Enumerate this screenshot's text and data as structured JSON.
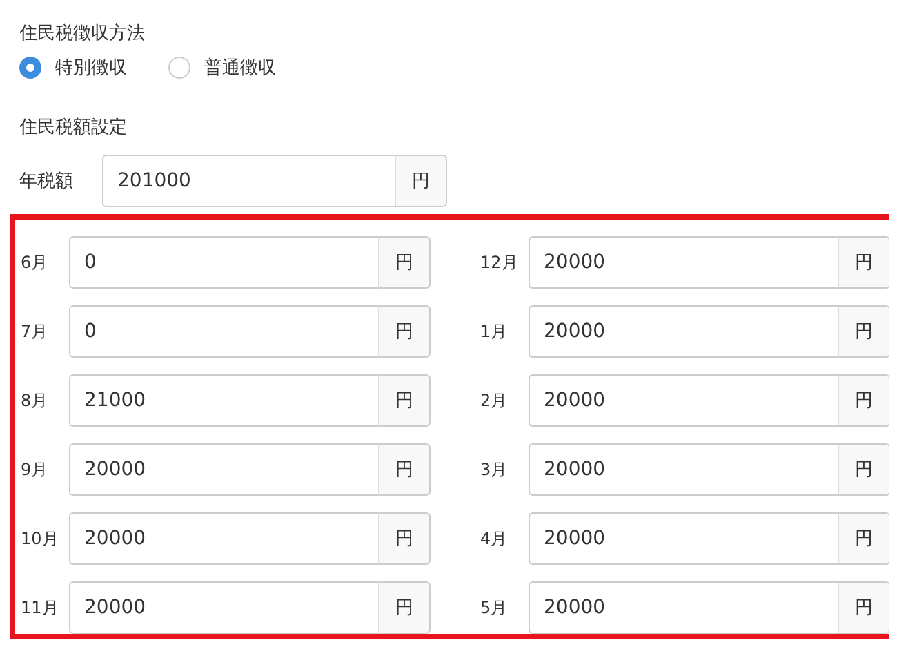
{
  "method": {
    "label": "住民税徴収方法",
    "options": [
      {
        "label": "特別徴収",
        "selected": true
      },
      {
        "label": "普通徴収",
        "selected": false
      }
    ]
  },
  "amount_section": {
    "label": "住民税額設定",
    "annual": {
      "label": "年税額",
      "value": "201000",
      "unit": "円"
    }
  },
  "monthly_columns": [
    [
      {
        "month": "6月",
        "value": "0",
        "unit": "円"
      },
      {
        "month": "7月",
        "value": "0",
        "unit": "円"
      },
      {
        "month": "8月",
        "value": "21000",
        "unit": "円"
      },
      {
        "month": "9月",
        "value": "20000",
        "unit": "円"
      },
      {
        "month": "10月",
        "value": "20000",
        "unit": "円"
      },
      {
        "month": "11月",
        "value": "20000",
        "unit": "円"
      }
    ],
    [
      {
        "month": "12月",
        "value": "20000",
        "unit": "円"
      },
      {
        "month": "1月",
        "value": "20000",
        "unit": "円"
      },
      {
        "month": "2月",
        "value": "20000",
        "unit": "円"
      },
      {
        "month": "3月",
        "value": "20000",
        "unit": "円"
      },
      {
        "month": "4月",
        "value": "20000",
        "unit": "円"
      },
      {
        "month": "5月",
        "value": "20000",
        "unit": "円"
      }
    ]
  ]
}
